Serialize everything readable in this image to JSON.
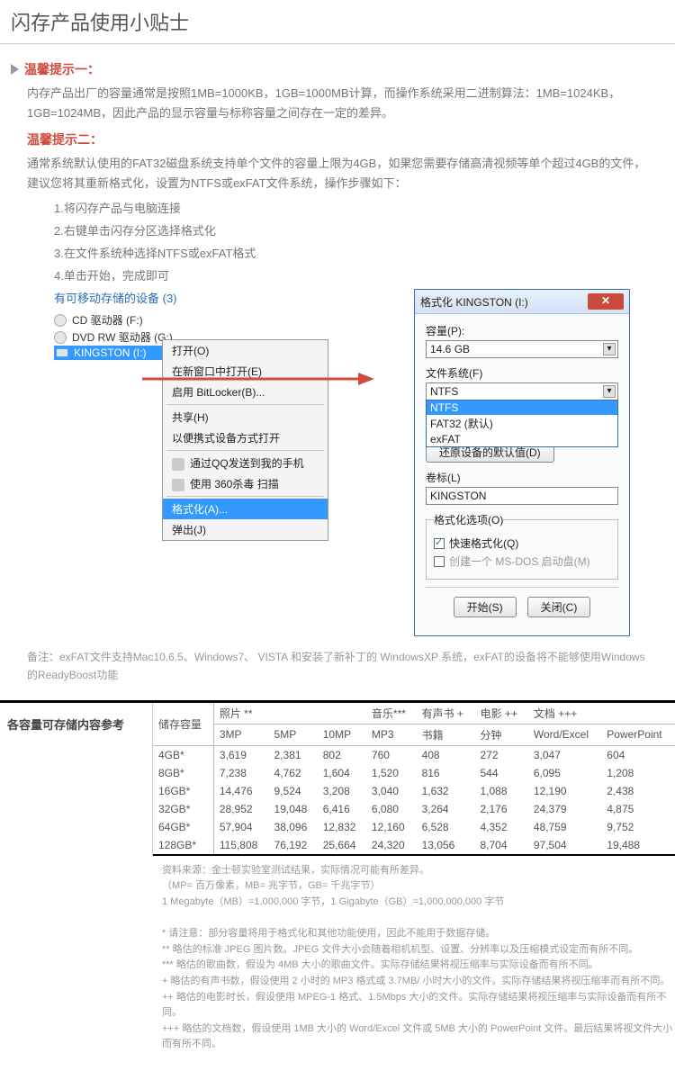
{
  "title": "闪存产品使用小贴士",
  "tip1_title": "温馨提示一：",
  "tip1_body": "内存产品出厂的容量通常是按照1MB=1000KB，1GB=1000MB计算，而操作系统采用二进制算法：1MB=1024KB，1GB=1024MB，因此产品的显示容量与标称容量之间存在一定的差异。",
  "tip2_title": "温馨提示二：",
  "tip2_body": "通常系统默认使用的FAT32磁盘系统支持单个文件的容量上限为4GB，如果您需要存储高清视频等单个超过4GB的文件，建议您将其重新格式化，设置为NTFS或exFAT文件系统，操作步骤如下：",
  "steps": [
    "1.将闪存产品与电脑连接",
    "2.右键单击闪存分区选择格式化",
    "3.在文件系统种选择NTFS或exFAT格式",
    "4.单击开始，完成即可"
  ],
  "devices_title": "有可移动存储的设备 (3)",
  "devices": [
    {
      "label": "CD 驱动器 (F:)"
    },
    {
      "label": "DVD RW 驱动器 (G:)"
    },
    {
      "label": "KINGSTON (I:)"
    }
  ],
  "ctx": {
    "open": "打开(O)",
    "newwin": "在新窗口中打开(E)",
    "bitlocker": "启用 BitLocker(B)...",
    "share": "共享(H)",
    "portable": "以便携式设备方式打开",
    "qq": "通过QQ发送到我的手机",
    "av": "使用 360杀毒 扫描",
    "format": "格式化(A)...",
    "eject": "弹出(J)"
  },
  "dlg": {
    "title": "格式化 KINGSTON (I:)",
    "cap_label": "容量(P):",
    "cap_value": "14.6 GB",
    "fs_label": "文件系统(F)",
    "fs_value": "NTFS",
    "fs_opts": [
      "NTFS",
      "FAT32 (默认)",
      "exFAT"
    ],
    "restore": "还原设备的默认值(D)",
    "vol_label": "卷标(L)",
    "vol_value": "KINGSTON",
    "opt_legend": "格式化选项(O)",
    "quick": "快速格式化(Q)",
    "msdos": "创建一个 MS-DOS 启动盘(M)",
    "start": "开始(S)",
    "close": "关闭(C)"
  },
  "note2": "备注：exFAT文件支持Mac10.6.5、Windows7、 VISTA  和安装了新补丁的 WindowsXP 系统，exFAT的设备将不能够使用Windows的ReadyBoost功能",
  "table_side": "各容量可存储内容参考",
  "groups": [
    "储存容量",
    "照片 **",
    "音乐***",
    "有声书 +",
    "电影 ++",
    "文档 +++"
  ],
  "subs": [
    "3MP",
    "5MP",
    "10MP",
    "MP3",
    "书籍",
    "分钟",
    "Word/Excel",
    "PowerPoint"
  ],
  "rows": [
    {
      "c": "4GB*",
      "v": [
        "3,619",
        "2,381",
        "802",
        "760",
        "408",
        "272",
        "3,047",
        "604"
      ]
    },
    {
      "c": "8GB*",
      "v": [
        "7,238",
        "4,762",
        "1,604",
        "1,520",
        "816",
        "544",
        "6,095",
        "1,208"
      ]
    },
    {
      "c": "16GB*",
      "v": [
        "14,476",
        "9,524",
        "3,208",
        "3,040",
        "1,632",
        "1,088",
        "12,190",
        "2,438"
      ]
    },
    {
      "c": "32GB*",
      "v": [
        "28,952",
        "19,048",
        "6,416",
        "6,080",
        "3,264",
        "2,176",
        "24,379",
        "4,875"
      ]
    },
    {
      "c": "64GB*",
      "v": [
        "57,904",
        "38,096",
        "12,832",
        "12,160",
        "6,528",
        "4,352",
        "48,759",
        "9,752"
      ]
    },
    {
      "c": "128GB*",
      "v": [
        "115,808",
        "76,192",
        "25,664",
        "24,320",
        "13,056",
        "8,704",
        "97,504",
        "19,488"
      ]
    }
  ],
  "foot": [
    "资料来源：金士顿实验室测试结果，实际情况可能有所差异。",
    "（MP= 百万像素，MB= 兆字节，GB= 千兆字节）",
    "1 Megabyte（MB）=1,000,000 字节，1 Gigabyte（GB）=1,000,000,000 字节",
    "",
    "* 请注意：部分容量将用于格式化和其他功能使用，因此不能用于数据存储。",
    "** 略估的标准 JPEG 图片数。JPEG 文件大小会随着相机机型、设置、分辨率以及压缩模式设定而有所不同。",
    "*** 略估的歌曲数，假设为 4MB 大小的歌曲文件。实际存储结果将视压缩率与实际设备而有所不同。",
    "+ 略估的有声书数，假设使用 2 小时的 MP3 格式或 3.7MB/ 小时大小的文件。实际存储结果将视压缩率而有所不同。",
    "++ 略估的电影时长，假设使用 MPEG-1 格式、1.5Mbps 大小的文件。实际存储结果将视压缩率与实际设备而有所不同。",
    "+++ 略估的文档数，假设使用 1MB 大小的 Word/Excel 文件或 5MB 大小的 PowerPoint 文件。最后结果将视文件大小而有所不同。"
  ]
}
